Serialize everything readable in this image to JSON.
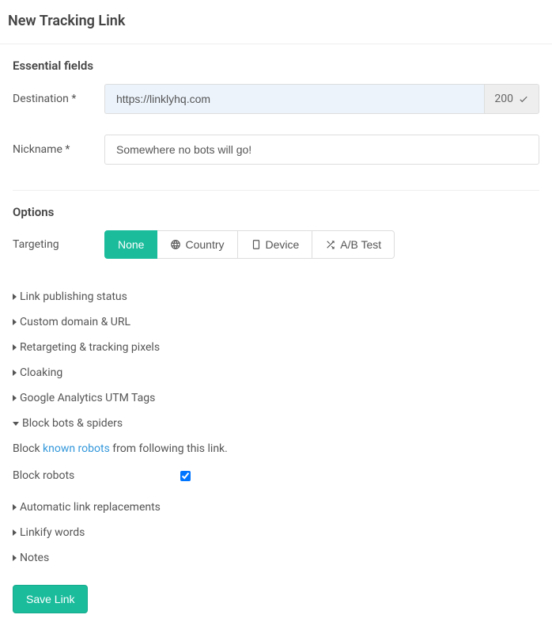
{
  "header": {
    "title": "New Tracking Link"
  },
  "essential": {
    "section_title": "Essential fields",
    "destination_label": "Destination *",
    "destination_value": "https://linklyhq.com",
    "status_code": "200",
    "nickname_label": "Nickname *",
    "nickname_value": "Somewhere no bots will go!"
  },
  "options": {
    "section_title": "Options",
    "targeting_label": "Targeting",
    "tabs": {
      "none": "None",
      "country": "Country",
      "device": "Device",
      "abtest": "A/B Test"
    },
    "items": {
      "publishing": "Link publishing status",
      "customdomain": "Custom domain & URL",
      "retargeting": "Retargeting & tracking pixels",
      "cloaking": "Cloaking",
      "utm": "Google Analytics UTM Tags",
      "blockbots": "Block bots & spiders",
      "autoreplace": "Automatic link replacements",
      "linkify": "Linkify words",
      "notes": "Notes"
    },
    "block_desc_pre": "Block ",
    "block_desc_link": "known robots",
    "block_desc_post": " from following this link.",
    "block_robots_label": "Block robots",
    "block_robots_checked": true
  },
  "save_label": "Save Link"
}
